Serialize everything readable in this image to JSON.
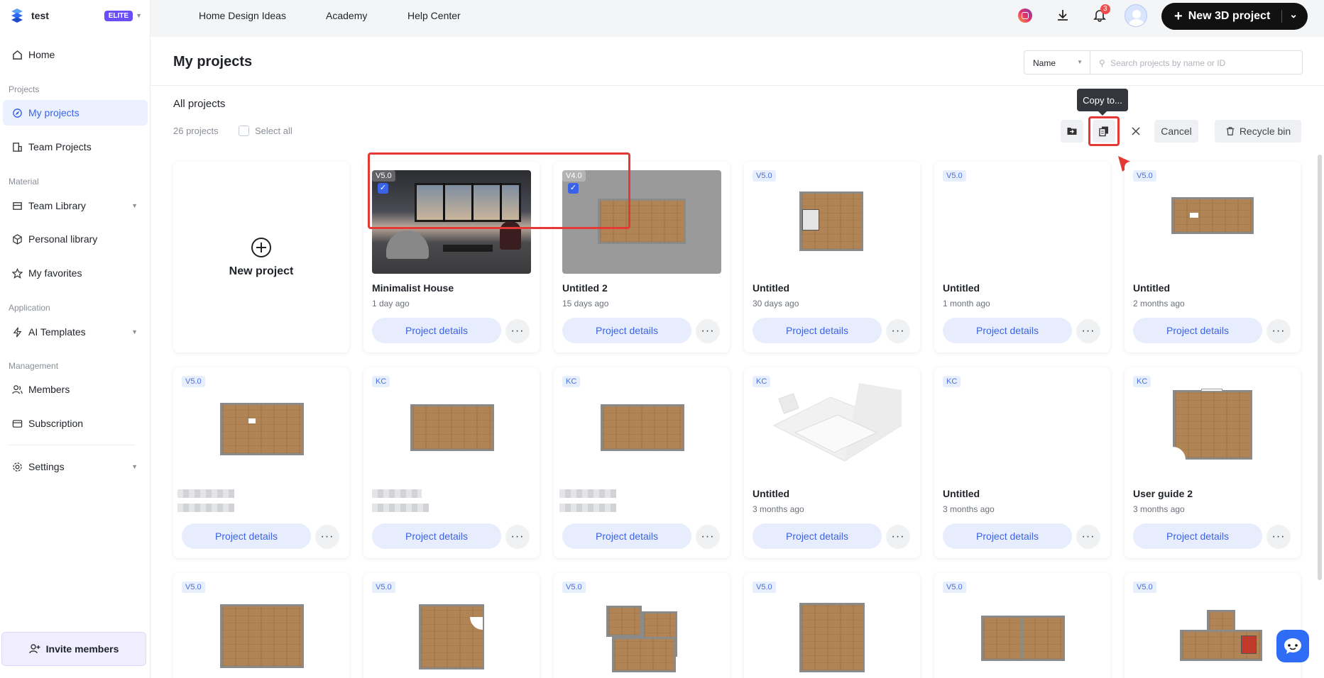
{
  "brand": {
    "name": "test",
    "badge": "ELITE"
  },
  "sidebar": {
    "home": "Home",
    "section_projects": "Projects",
    "my_projects": "My projects",
    "team_projects": "Team Projects",
    "section_material": "Material",
    "team_library": "Team Library",
    "personal_library": "Personal library",
    "my_favorites": "My favorites",
    "section_application": "Application",
    "ai_templates": "AI Templates",
    "section_management": "Management",
    "members": "Members",
    "subscription": "Subscription",
    "settings": "Settings",
    "invite": "Invite members"
  },
  "topbar": {
    "links": [
      "Home Design Ideas",
      "Academy",
      "Help Center"
    ],
    "notification_count": "3",
    "new_project": "New 3D project"
  },
  "main": {
    "title": "My projects",
    "sort_select": "Name",
    "search_placeholder": "Search projects by name or ID",
    "section_title": "All projects",
    "count": "26 projects",
    "select_all": "Select all",
    "tooltip": "Copy to...",
    "cancel": "Cancel",
    "recycle_bin": "Recycle bin",
    "new_project_card": "New project",
    "details_label": "Project details"
  },
  "projects": [
    {
      "badge": "V5.0",
      "title": "Minimalist House",
      "time": "1 day ago",
      "checked": true
    },
    {
      "badge": "V4.0",
      "title": "Untitled 2",
      "time": "15 days ago",
      "checked": true
    },
    {
      "badge": "V5.0",
      "title": "Untitled",
      "time": "30 days ago"
    },
    {
      "badge": "V5.0",
      "title": "Untitled",
      "time": "1 month ago"
    },
    {
      "badge": "V5.0",
      "title": "Untitled",
      "time": "2 months ago"
    },
    {
      "badge": "V5.0",
      "title": "",
      "time": ""
    },
    {
      "badge": "KC",
      "title": "",
      "time": ""
    },
    {
      "badge": "KC",
      "title": "",
      "time": ""
    },
    {
      "badge": "KC",
      "title": "Untitled",
      "time": "3 months ago"
    },
    {
      "badge": "KC",
      "title": "Untitled",
      "time": "3 months ago"
    },
    {
      "badge": "KC",
      "title": "User guide 2",
      "time": "3 months ago"
    },
    {
      "badge": "V5.0"
    },
    {
      "badge": "V5.0"
    },
    {
      "badge": "V5.0"
    },
    {
      "badge": "V5.0"
    },
    {
      "badge": "V5.0"
    },
    {
      "badge": "V5.0"
    }
  ],
  "colors": {
    "accent": "#3a63e8",
    "elite": "#6b4dfa",
    "highlight": "#e53935"
  }
}
